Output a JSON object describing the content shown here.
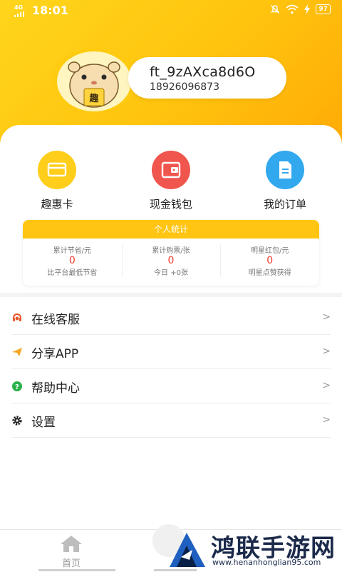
{
  "status_bar": {
    "network": "4G",
    "time": "18:01",
    "battery": "97"
  },
  "profile": {
    "avatar_text": "趣",
    "username": "ft_9zAXca8d6O",
    "phone": "18926096873"
  },
  "quick_actions": [
    {
      "label": "趣惠卡",
      "icon": "card-icon",
      "color": "#ffce1a"
    },
    {
      "label": "现金钱包",
      "icon": "wallet-icon",
      "color": "#f0564d"
    },
    {
      "label": "我的订单",
      "icon": "order-document-icon",
      "color": "#32a8ee"
    }
  ],
  "stats": {
    "title": "个人统计",
    "items": [
      {
        "label": "累计节省/元",
        "value": "0",
        "sub": "比平台最低节省"
      },
      {
        "label": "累计购票/张",
        "value": "0",
        "sub": "今日 +0张"
      },
      {
        "label": "明星红包/元",
        "value": "0",
        "sub": "明星点赞获得"
      }
    ]
  },
  "menu": [
    {
      "label": "在线客服",
      "icon": "customer-service-icon",
      "color": "#e8542c"
    },
    {
      "label": "分享APP",
      "icon": "paper-plane-icon",
      "color": "#f5a623"
    },
    {
      "label": "帮助中心",
      "icon": "help-icon",
      "color": "#2bb14b"
    },
    {
      "label": "设置",
      "icon": "gear-icon",
      "color": "#222222"
    }
  ],
  "chevron": ">",
  "tabbar": {
    "home_label": "首页"
  },
  "watermark": {
    "title": "鸿联手游网",
    "url": "www.henanhonglian95.com"
  },
  "colors": {
    "header_yellow": "#ffc40e",
    "stats_value_red": "#f03a2e"
  }
}
